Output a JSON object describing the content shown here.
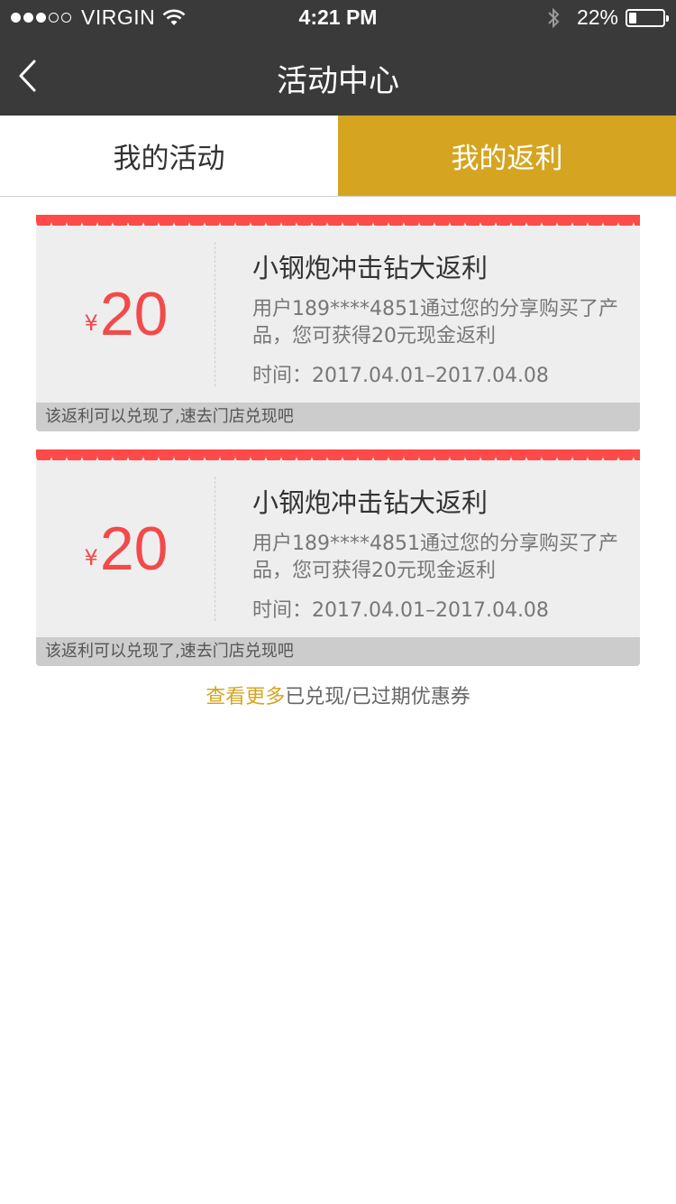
{
  "status_bar": {
    "carrier": "VIRGIN",
    "time": "4:21 PM",
    "battery": "22%",
    "battery_level": 0.22
  },
  "nav": {
    "title": "活动中心",
    "back_icon": "chevron-left-icon"
  },
  "tabs": [
    {
      "label": "我的活动",
      "active": false
    },
    {
      "label": "我的返利",
      "active": true
    }
  ],
  "coupons": [
    {
      "currency": "¥",
      "amount": "20",
      "title": "小钢炮冲击钻大返利",
      "description": "用户189****4851通过您的分享购买了产品，您可获得20元现金返利",
      "time": "时间：2017.04.01–2017.04.08",
      "footer": "该返利可以兑现了,速去门店兑现吧"
    },
    {
      "currency": "¥",
      "amount": "20",
      "title": "小钢炮冲击钻大返利",
      "description": "用户189****4851通过您的分享购买了产品，您可获得20元现金返利",
      "time": "时间：2017.04.01–2017.04.08",
      "footer": "该返利可以兑现了,速去门店兑现吧"
    }
  ],
  "more": {
    "link_text": "查看更多",
    "rest_text": "已兑现/已过期优惠券"
  },
  "colors": {
    "header_bg": "#3a3a3a",
    "accent_gold": "#d5a521",
    "coupon_red": "#f24a4a",
    "scallop_red": "#ff4a4a"
  }
}
